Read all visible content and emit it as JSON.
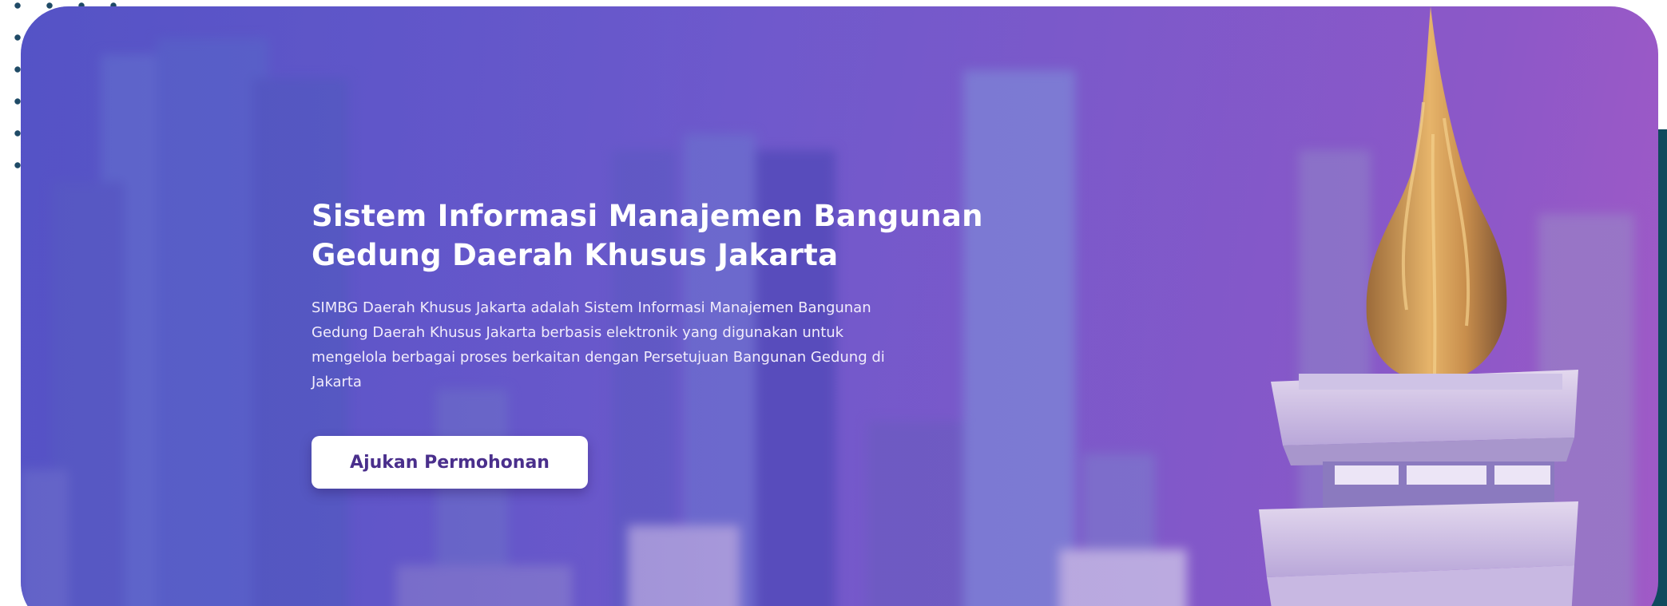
{
  "hero": {
    "title_lines": [
      "Sistem Informasi Manajemen Bangunan",
      "Gedung Daerah Khusus Jakarta"
    ],
    "description_lines": [
      "SIMBG Daerah Khusus Jakarta adalah Sistem Informasi Manajemen Bangunan",
      "Gedung Daerah Khusus Jakarta berbasis elektronik yang digunakan untuk",
      "mengelola berbagai proses berkaitan dengan Persetujuan Bangunan Gedung di",
      "Jakarta"
    ],
    "cta_label": "Ajukan Permohonan"
  },
  "colors": {
    "accent_dark": "#0f4a5e",
    "dots": "#1f4a66",
    "button_text": "#4a2f8c",
    "hero_gradient_start": "#5a62cf",
    "hero_gradient_end": "#a45ac6"
  }
}
